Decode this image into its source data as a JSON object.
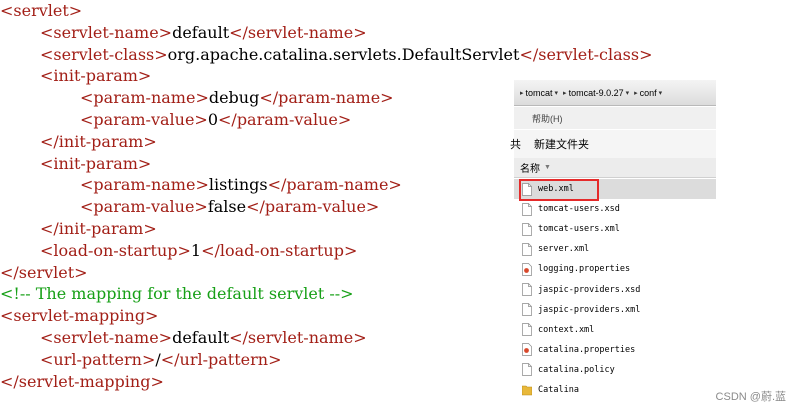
{
  "code_lines": [
    {
      "indent": 0,
      "parts": [
        [
          "tag",
          "<servlet>"
        ]
      ]
    },
    {
      "indent": 1,
      "parts": [
        [
          "tag",
          "<servlet-name>"
        ],
        [
          "txt",
          "default"
        ],
        [
          "tag",
          "</servlet-name>"
        ]
      ]
    },
    {
      "indent": 1,
      "parts": [
        [
          "tag",
          "<servlet-class>"
        ],
        [
          "txt",
          "org.apache.catalina.servlets.DefaultServlet"
        ],
        [
          "tag",
          "</servlet-class>"
        ]
      ]
    },
    {
      "indent": 1,
      "parts": [
        [
          "tag",
          "<init-param>"
        ]
      ]
    },
    {
      "indent": 2,
      "parts": [
        [
          "tag",
          "<param-name>"
        ],
        [
          "txt",
          "debug"
        ],
        [
          "tag",
          "</param-name>"
        ]
      ]
    },
    {
      "indent": 2,
      "parts": [
        [
          "tag",
          "<param-value>"
        ],
        [
          "txt",
          "0"
        ],
        [
          "tag",
          "</param-value>"
        ]
      ]
    },
    {
      "indent": 1,
      "parts": [
        [
          "tag",
          "</init-param>"
        ]
      ]
    },
    {
      "indent": 1,
      "parts": [
        [
          "tag",
          "<init-param>"
        ]
      ]
    },
    {
      "indent": 2,
      "parts": [
        [
          "tag",
          "<param-name>"
        ],
        [
          "txt",
          "listings"
        ],
        [
          "tag",
          "</param-name>"
        ]
      ]
    },
    {
      "indent": 2,
      "parts": [
        [
          "tag",
          "<param-value>"
        ],
        [
          "txt",
          "false"
        ],
        [
          "tag",
          "</param-value>"
        ]
      ]
    },
    {
      "indent": 1,
      "parts": [
        [
          "tag",
          "</init-param>"
        ]
      ]
    },
    {
      "indent": 1,
      "parts": [
        [
          "tag",
          "<load-on-startup>"
        ],
        [
          "txt",
          "1"
        ],
        [
          "tag",
          "</load-on-startup>"
        ]
      ]
    },
    {
      "indent": 0,
      "parts": [
        [
          "tag",
          "</servlet>"
        ]
      ]
    },
    {
      "indent": 0,
      "parts": [
        [
          "cmt",
          "<!-- The mapping for the default servlet -->"
        ]
      ]
    },
    {
      "indent": 0,
      "parts": [
        [
          "tag",
          "<servlet-mapping>"
        ]
      ]
    },
    {
      "indent": 1,
      "parts": [
        [
          "tag",
          "<servlet-name>"
        ],
        [
          "txt",
          "default"
        ],
        [
          "tag",
          "</servlet-name>"
        ]
      ]
    },
    {
      "indent": 1,
      "parts": [
        [
          "tag",
          "<url-pattern>"
        ],
        [
          "txt",
          "/"
        ],
        [
          "tag",
          "</url-pattern>"
        ]
      ]
    },
    {
      "indent": 0,
      "parts": [
        [
          "tag",
          "</servlet-mapping>"
        ]
      ]
    }
  ],
  "colors": {
    "tag": "#a21f17",
    "text": "#000000",
    "comment": "#17a017",
    "highlight": "#e52a2a"
  },
  "explorer": {
    "breadcrumbs": [
      "tomcat",
      "tomcat-9.0.27",
      "conf"
    ],
    "menu_help": "帮助(H)",
    "toolbar_cut": "共",
    "new_folder": "新建文件夹",
    "column_name": "名称",
    "files": [
      {
        "name": "web.xml",
        "icon": "document-icon",
        "selected": true
      },
      {
        "name": "tomcat-users.xsd",
        "icon": "document-icon"
      },
      {
        "name": "tomcat-users.xml",
        "icon": "document-icon"
      },
      {
        "name": "server.xml",
        "icon": "document-icon"
      },
      {
        "name": "logging.properties",
        "icon": "properties-file-icon"
      },
      {
        "name": "jaspic-providers.xsd",
        "icon": "document-icon"
      },
      {
        "name": "jaspic-providers.xml",
        "icon": "document-icon"
      },
      {
        "name": "context.xml",
        "icon": "document-icon"
      },
      {
        "name": "catalina.properties",
        "icon": "properties-file-icon"
      },
      {
        "name": "catalina.policy",
        "icon": "document-icon"
      },
      {
        "name": "Catalina",
        "icon": "folder-icon"
      }
    ]
  },
  "watermark": "CSDN @蔚.蓝"
}
